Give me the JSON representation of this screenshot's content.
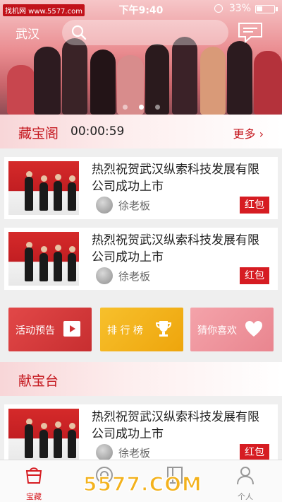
{
  "status": {
    "watermark": "找机网 www.5577.com",
    "time": "下午9:40",
    "battery": "33%"
  },
  "header": {
    "city": "武汉"
  },
  "banner": {
    "dot_count": 3,
    "active_dot": 1
  },
  "treasure_pavilion": {
    "title": "藏宝阁",
    "countdown": "00:00:59",
    "more_label": "更多",
    "items": [
      {
        "title": "热烈祝贺武汉纵索科技发展有限公司成功上市",
        "author": "徐老板",
        "tag": "红包"
      },
      {
        "title": "热烈祝贺武汉纵索科技发展有限公司成功上市",
        "author": "徐老板",
        "tag": "红包"
      }
    ]
  },
  "actions": [
    {
      "label": "活动预告",
      "icon": "play-icon",
      "color": "#d93a3c"
    },
    {
      "label": "排 行 榜",
      "icon": "trophy-icon",
      "color": "#f2b21a"
    },
    {
      "label": "猜你喜欢",
      "icon": "heart-icon",
      "color": "#ee939b"
    }
  ],
  "offering_stage": {
    "title": "献宝台",
    "items": [
      {
        "title": "热烈祝贺武汉纵索科技发展有限公司成功上市",
        "author": "徐老板",
        "tag": "红包"
      }
    ]
  },
  "bottom_nav": [
    {
      "label": "宝藏",
      "icon": "treasure-bag-icon",
      "active": true
    },
    {
      "label": "",
      "icon": "shop-icon",
      "active": false
    },
    {
      "label": "",
      "icon": "news-icon",
      "active": false
    },
    {
      "label": "个人",
      "icon": "person-icon",
      "active": false
    }
  ],
  "site_watermark": "5577.COM",
  "colors": {
    "accent": "#d61c22",
    "title_red": "#c51a21"
  }
}
